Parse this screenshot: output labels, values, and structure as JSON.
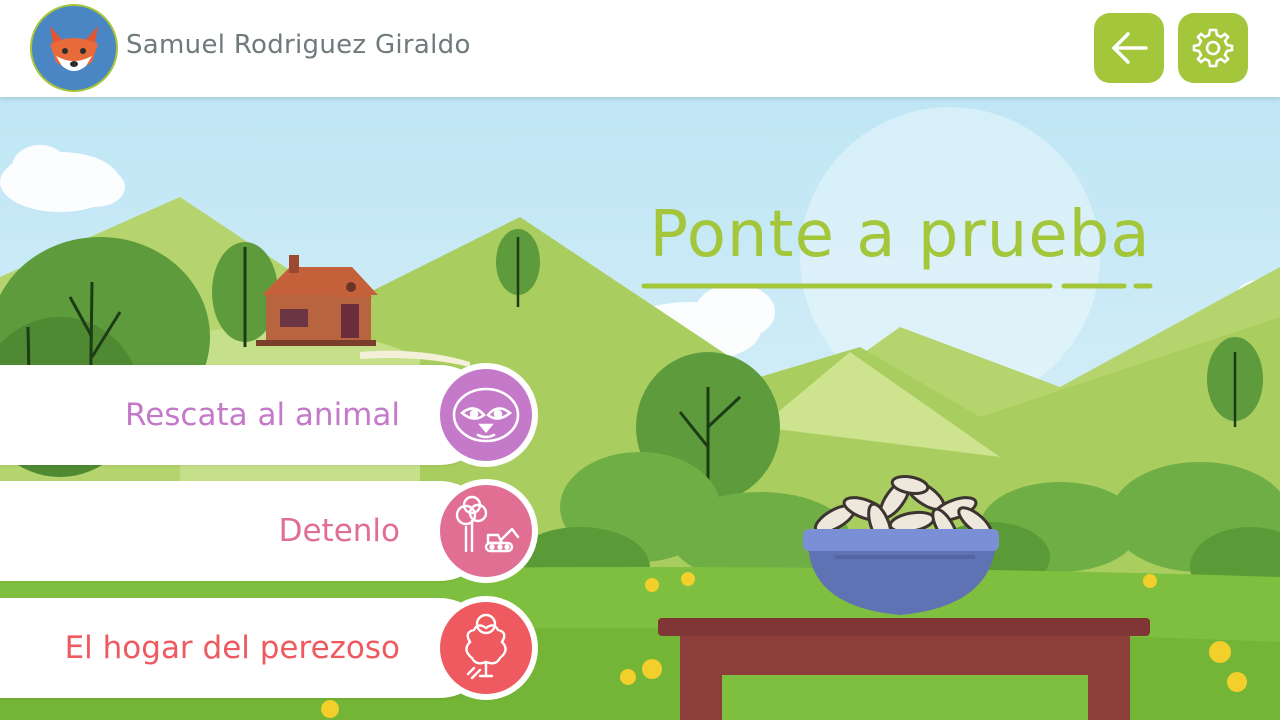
{
  "user": {
    "name": "Samuel Rodriguez Giraldo",
    "avatar_icon": "fox-avatar-icon"
  },
  "header": {
    "back_icon": "arrow-left-icon",
    "settings_icon": "gear-icon",
    "accent_color": "#a3c63b"
  },
  "title": "Ponte a prueba",
  "menu": [
    {
      "label": "Rescata al animal",
      "icon": "sloth-face-icon",
      "color": "#c57ac9"
    },
    {
      "label": "Detenlo",
      "icon": "tree-bulldozer-icon",
      "color": "#e06f93"
    },
    {
      "label": "El hogar del perezoso",
      "icon": "sloth-in-tree-icon",
      "color": "#ee5a5f"
    }
  ]
}
